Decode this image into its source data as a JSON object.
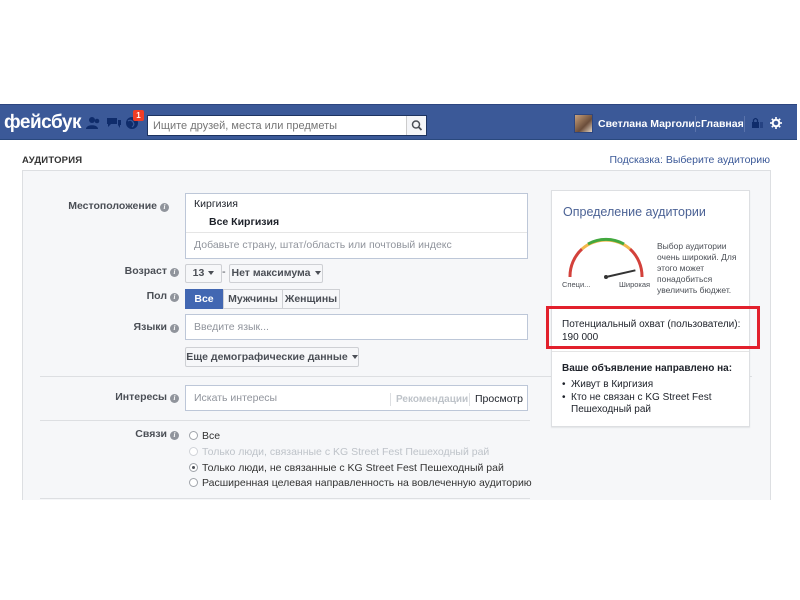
{
  "topbar": {
    "logo": "фейсбук",
    "notification_count": "1",
    "search_placeholder": "Ищите друзей, места или предметы",
    "user_name": "Светлана Марголис",
    "home_label": "Главная"
  },
  "header": {
    "section_title": "АУДИТОРИЯ",
    "hint": "Подсказка: Выберите аудиторию"
  },
  "form": {
    "location": {
      "label": "Местоположение",
      "country": "Киргизия",
      "entry": "Все Киргизия",
      "placeholder": "Добавьте страну, штат/область или почтовый индекс"
    },
    "age": {
      "label": "Возраст",
      "from": "13",
      "dash": "-",
      "to": "Нет максимума"
    },
    "gender": {
      "label": "Пол",
      "options": [
        "Все",
        "Мужчины",
        "Женщины"
      ],
      "selected": "Все"
    },
    "languages": {
      "label": "Языки",
      "placeholder": "Введите язык..."
    },
    "more_demographics": "Еще демографические данные",
    "interests": {
      "label": "Интересы",
      "placeholder": "Искать интересы",
      "recommendations": "Рекомендации",
      "browse": "Просмотр"
    },
    "connections": {
      "label": "Связи",
      "options": [
        "Все",
        "Только люди, связанные с KG Street Fest Пешеходный рай",
        "Только люди, не связанные с KG Street Fest Пешеходный рай",
        "Расширенная целевая направленность на вовлеченную аудиторию"
      ],
      "selected_index": 2
    }
  },
  "definition": {
    "title": "Определение аудитории",
    "gauge_left": "Специ...",
    "gauge_right": "Широкая",
    "gauge_level": 0.85,
    "description": "Выбор аудитории очень широкий. Для этого может понадобиться увеличить бюджет.",
    "reach_label": "Потенциальный охват (пользователи):",
    "reach_value": "190 000",
    "target_title": "Ваше объявление направлено на:",
    "targets": [
      "Живут в Киргизия",
      "Кто не связан с KG Street Fest Пешеходный рай"
    ]
  },
  "colors": {
    "topbar": "#3b5998",
    "accent": "#4267b2",
    "highlight": "#e2202c"
  }
}
